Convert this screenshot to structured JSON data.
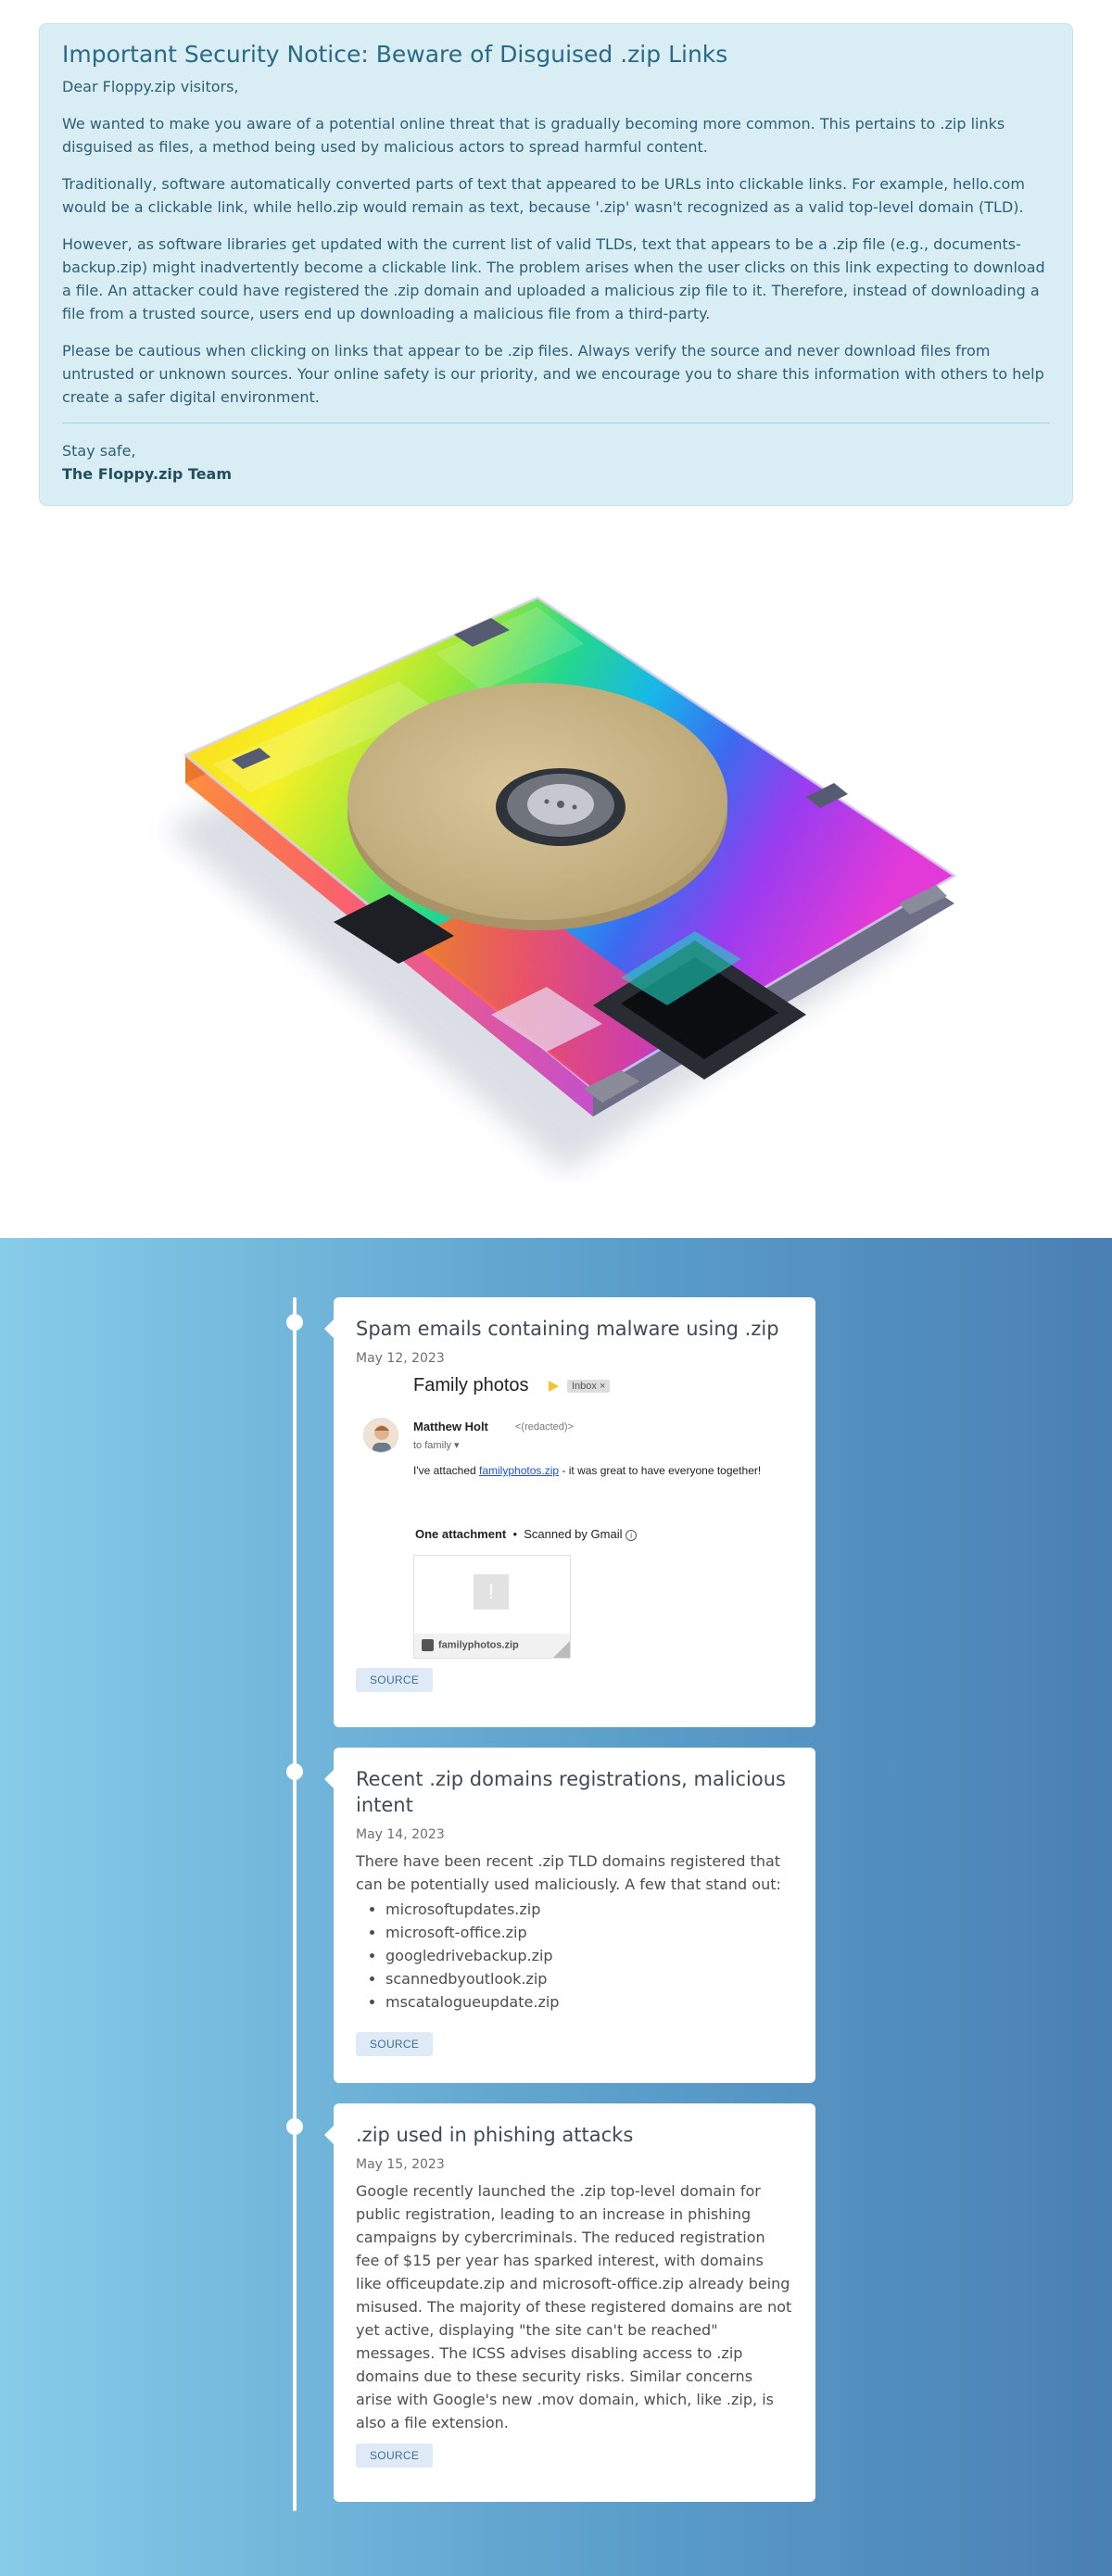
{
  "notice": {
    "title": "Important Security Notice: Beware of Disguised .zip Links",
    "greeting": "Dear Floppy.zip visitors,",
    "paragraphs": [
      "We wanted to make you aware of a potential online threat that is gradually becoming more common. This pertains to .zip links disguised as files, a method being used by malicious actors to spread harmful content.",
      "Traditionally, software automatically converted parts of text that appeared to be URLs into clickable links. For example, hello.com would be a clickable link, while hello.zip would remain as text, because '.zip' wasn't recognized as a valid top-level domain (TLD).",
      "However, as software libraries get updated with the current list of valid TLDs, text that appears to be a .zip file (e.g., documents-backup.zip) might inadvertently become a clickable link. The problem arises when the user clicks on this link expecting to download a file. An attacker could have registered the .zip domain and uploaded a malicious zip file to it. Therefore, instead of downloading a file from a trusted source, users end up downloading a malicious file from a third-party.",
      "Please be cautious when clicking on links that appear to be .zip files. Always verify the source and never download files from untrusted or unknown sources. Your online safety is our priority, and we encourage you to share this information with others to help create a safer digital environment."
    ],
    "signoff": "Stay safe,",
    "team": "The Floppy.zip Team"
  },
  "hero": {
    "icon": "rainbow-floppy-disk-illustration",
    "colors": {
      "disk": "#cdb98a",
      "hub": "#3b3f46"
    }
  },
  "timeline": {
    "background_from": "#87cce9",
    "background_to": "#4a80b3",
    "cards": [
      {
        "title": "Spam emails containing malware using .zip",
        "date": "May 12, 2023",
        "source_label": "SOURCE",
        "email": {
          "subject": "Family photos",
          "label": "Inbox ×",
          "sender_name": "Matthew Holt",
          "sender_email": "<(redacted)>",
          "to": "to family",
          "message_prefix": "I've attached",
          "message_link": "familyphotos.zip",
          "message_suffix": "- it was great to have everyone together!",
          "attachment_heading": "One attachment",
          "scanned": "Scanned by Gmail",
          "file_name": "familyphotos.zip"
        }
      },
      {
        "title": "Recent .zip domains registrations, malicious intent",
        "date": "May 14, 2023",
        "body": "There have been recent .zip TLD domains registered that can be potentially used maliciously. A few that stand out:",
        "domains": [
          "microsoftupdates.zip",
          "microsoft-office.zip",
          "googledrivebackup.zip",
          "scannedbyoutlook.zip",
          "mscatalogueupdate.zip"
        ],
        "source_label": "SOURCE"
      },
      {
        "title": ".zip used in phishing attacks",
        "date": "May 15, 2023",
        "body": "Google recently launched the .zip top-level domain for public registration, leading to an increase in phishing campaigns by cybercriminals. The reduced registration fee of $15 per year has sparked interest, with domains like officeupdate.zip and microsoft-office.zip already being misused. The majority of these registered domains are not yet active, displaying \"the site can't be reached\" messages. The ICSS advises disabling access to .zip domains due to these security risks. Similar concerns arise with Google's new .mov domain, which, like .zip, is also a file extension.",
        "source_label": "SOURCE"
      }
    ]
  }
}
